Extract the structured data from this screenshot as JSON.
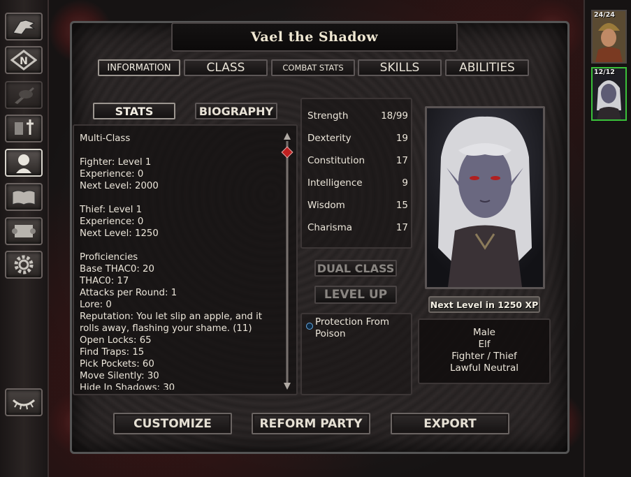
{
  "title": "Vael the Shadow",
  "tabs": [
    {
      "label": "INFORMATION"
    },
    {
      "label": "CLASS"
    },
    {
      "label": "COMBAT STATS"
    },
    {
      "label": "SKILLS"
    },
    {
      "label": "ABILITIES"
    }
  ],
  "subtabs": [
    {
      "label": "STATS"
    },
    {
      "label": "BIOGRAPHY"
    }
  ],
  "stats_lines": [
    "Multi-Class",
    "",
    "Fighter: Level 1",
    "Experience: 0",
    "Next Level: 2000",
    "",
    "Thief: Level 1",
    "Experience: 0",
    "Next Level: 1250",
    "",
    "Proficiencies",
    "Base THAC0: 20",
    "THAC0: 17",
    "Attacks per Round: 1",
    "Lore: 0",
    "Reputation: You let slip an apple, and it rolls away, flashing your shame. (11)",
    "Open Locks: 65",
    "Find Traps: 15",
    "Pick Pockets: 60",
    "Move Silently: 30",
    "Hide In Shadows: 30"
  ],
  "attributes": [
    {
      "name": "Strength",
      "value": "18/99"
    },
    {
      "name": "Dexterity",
      "value": "19"
    },
    {
      "name": "Constitution",
      "value": "17"
    },
    {
      "name": "Intelligence",
      "value": "9"
    },
    {
      "name": "Wisdom",
      "value": "15"
    },
    {
      "name": "Charisma",
      "value": "17"
    }
  ],
  "buttons": {
    "dual_class": "DUAL CLASS",
    "level_up": "LEVEL UP",
    "customize": "CUSTOMIZE",
    "reform_party": "REFORM PARTY",
    "export": "EXPORT"
  },
  "effects": [
    {
      "label": "Protection From Poison",
      "icon": "protection-icon"
    }
  ],
  "next_level_xp": "Next Level in 1250 XP",
  "character_info": {
    "gender": "Male",
    "race": "Elf",
    "class": "Fighter / Thief",
    "alignment": "Lawful Neutral"
  },
  "party": [
    {
      "hp": "24/24",
      "selected": false
    },
    {
      "hp": "12/12",
      "selected": true
    }
  ],
  "sidebar_icons": [
    "dragon-head-icon",
    "map-compass-icon",
    "journal-quill-icon",
    "inventory-sword-icon",
    "character-record-icon",
    "mage-book-icon",
    "priest-scroll-icon",
    "options-gear-icon"
  ],
  "colors": {
    "selected_party_border": "#3ac13a",
    "scroll_thumb": "#c02020"
  }
}
